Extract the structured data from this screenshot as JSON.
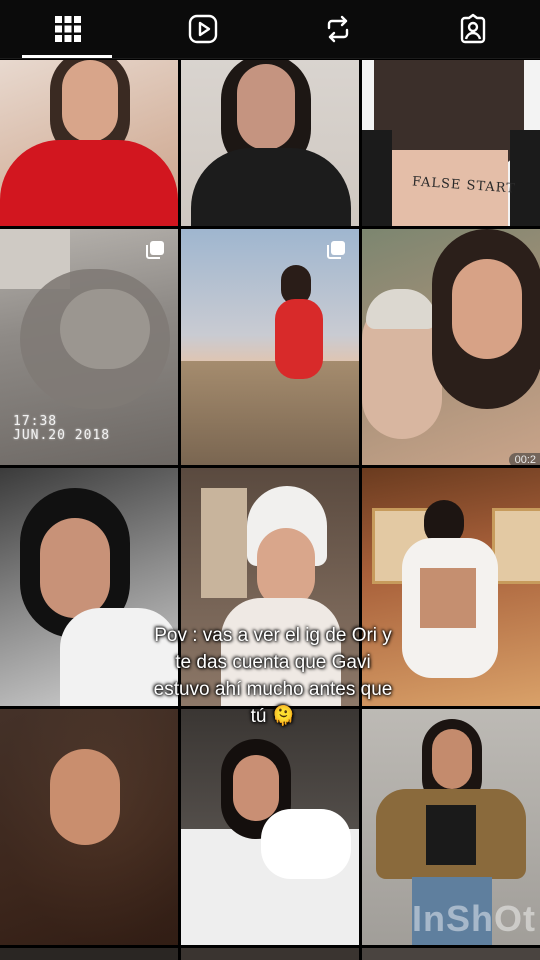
{
  "tabs": [
    {
      "name": "grid",
      "icon": "grid-icon"
    },
    {
      "name": "reels",
      "icon": "reels-play-icon"
    },
    {
      "name": "reposts",
      "icon": "repost-icon"
    },
    {
      "name": "tagged",
      "icon": "tagged-person-icon"
    }
  ],
  "active_tab": "grid",
  "grid": {
    "tiles": [
      {
        "tattoo_text": "FALSE START"
      },
      {
        "timestamp_time": "17:38",
        "timestamp_date": "JUN.20 2018",
        "badge": "multi-photo-icon"
      },
      {
        "badge": "multi-photo-icon"
      },
      {
        "video_duration": "00:2"
      }
    ]
  },
  "caption": {
    "line1": "Pov : vas a ver el ig de Ori y",
    "line2": "te das cuenta que Gavi",
    "line3": "estuvo ahí mucho antes que",
    "line4": "tú 🫠"
  },
  "watermark": "InShOt",
  "colors": {
    "background": "#000000",
    "tabbar": "#0b0b0b",
    "icon": "#ffffff",
    "indicator": "#ffffff"
  }
}
